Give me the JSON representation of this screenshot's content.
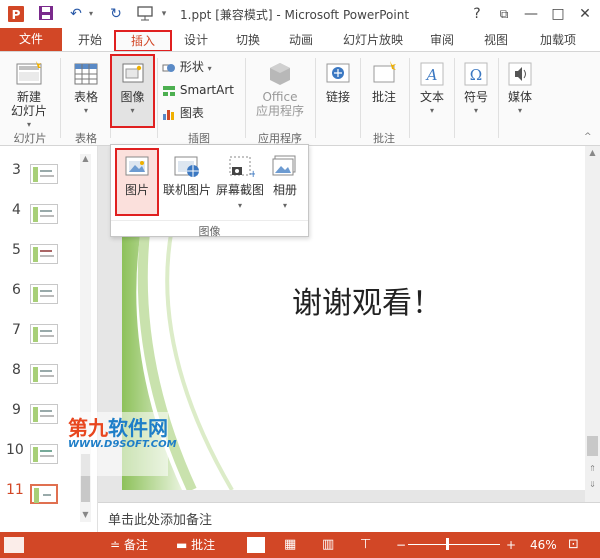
{
  "app": {
    "title": "1.ppt [兼容模式] - Microsoft PowerPoint",
    "quick_access": [
      "save-icon",
      "undo-icon",
      "redo-icon",
      "start-slideshow-icon"
    ],
    "window_controls": [
      "?",
      "⧉",
      "—",
      "□",
      "✕"
    ]
  },
  "tabs": {
    "file": "文件",
    "items": [
      "开始",
      "插入",
      "设计",
      "切换",
      "动画",
      "幻灯片放映",
      "审阅",
      "视图",
      "加载项"
    ],
    "active": "插入"
  },
  "ribbon": {
    "slides_group": {
      "new_slide": "新建\n幻灯片",
      "label": "幻灯片"
    },
    "tables_group": {
      "table": "表格",
      "label": "表格"
    },
    "images_group": {
      "image": "图像"
    },
    "illustrations": {
      "shapes": "形状",
      "smartart": "SmartArt",
      "chart": "图表",
      "label": "插图"
    },
    "apps": {
      "office_apps_line1": "Office",
      "office_apps_line2": "应用程序",
      "label": "应用程序"
    },
    "links": {
      "link": "链接"
    },
    "comments": {
      "comment": "批注",
      "label": "批注"
    },
    "text": {
      "text": "文本"
    },
    "symbols": {
      "symbol": "符号"
    },
    "media": {
      "media": "媒体"
    }
  },
  "dropdown": {
    "picture": "图片",
    "online_pictures": "联机图片",
    "screenshot": "屏幕截图",
    "album": "相册",
    "label": "图像"
  },
  "slide_panel": {
    "numbers": [
      "3",
      "4",
      "5",
      "6",
      "7",
      "8",
      "9",
      "10",
      "11"
    ],
    "selected": "11"
  },
  "slide": {
    "title": "谢谢观看！"
  },
  "notes": {
    "placeholder": "单击此处添加备注"
  },
  "status": {
    "notes": "备注",
    "comments": "批注",
    "zoom": "46%"
  },
  "watermark": {
    "line1a": "第九",
    "line1b": "软件网",
    "line2": "WWW.D9SOFT.COM"
  },
  "colors": {
    "accent": "#d24726",
    "highlight": "#e02020",
    "slide_green": "#8dc15a"
  }
}
